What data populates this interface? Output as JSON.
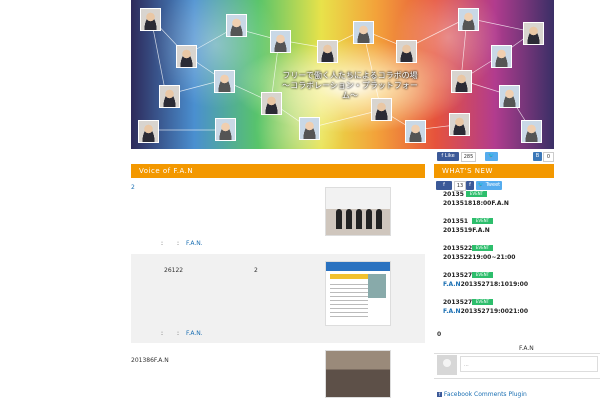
{
  "banner": {
    "tagline_line1": "フリーで働く人たちによるコラボの場",
    "tagline_line2": "〜コラボレーション・プラットフォーム〜"
  },
  "main": {
    "section_title": "Voice of F.A.N",
    "posts": [
      {
        "excerpt": "2",
        "meta_sep": ":",
        "meta_author": "F.A.N."
      },
      {
        "excerpt": "26122",
        "excerpt_num": "2",
        "meta_sep": ":",
        "meta_author": "F.A.N."
      },
      {
        "excerpt": "201386F.A.N"
      }
    ]
  },
  "sidebar": {
    "fb_like_label": "Like",
    "fb_like_count": "285",
    "tweet_label": "",
    "share_count": "0",
    "whats_new_title": "WHAT'S NEW",
    "small_like_count": "13",
    "tweet2_label": "Tweet",
    "events": [
      {
        "date": "20135",
        "badge": "EVENT",
        "line": "2013518",
        "line_tail": "18:00F.A.N"
      },
      {
        "date": "201351",
        "badge": "EVENT",
        "line": "2013519F.A.N"
      },
      {
        "date": "2013522",
        "badge": "EVENT",
        "line": "2013522",
        "line_tail": "19:00~21:00"
      },
      {
        "date": "2013527",
        "badge": "EVENT",
        "line_link": "F.A.N",
        "line": "2013527",
        "line_tail": "18:10",
        "line_tail2": "19:00"
      },
      {
        "date": "2013527",
        "badge": "EVENT",
        "line_link": "F.A.N",
        "line": "2013527",
        "line_tail": "19:00",
        "line_tail2": "21:00"
      }
    ],
    "comments_count": "0",
    "comment_input_placeholder": "...",
    "comment_user": "F.A.N",
    "comments_plugin_label": "Facebook Comments Plugin"
  },
  "colors": {
    "accent_orange": "#f39800",
    "event_green": "#2dbe6c",
    "facebook_blue": "#3b5998",
    "twitter_blue": "#55acee",
    "link_blue": "#1a6fb3"
  }
}
